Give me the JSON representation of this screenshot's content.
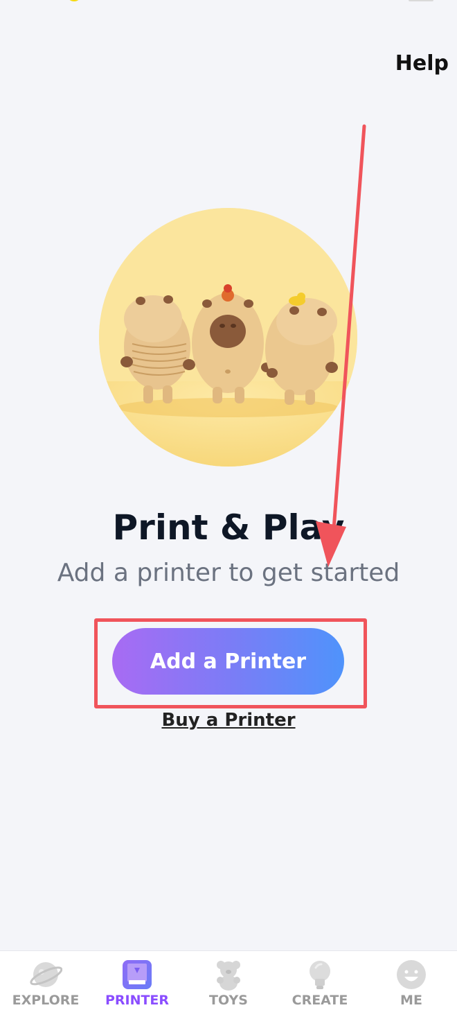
{
  "header": {
    "help_label": "Help"
  },
  "hero": {
    "title": "Print & Play",
    "subtitle": "Add a printer to get started"
  },
  "actions": {
    "add_printer_label": "Add a Printer",
    "buy_printer_label": "Buy a Printer"
  },
  "tabs": [
    {
      "label": "EXPLORE",
      "icon": "planet-icon",
      "active": false
    },
    {
      "label": "PRINTER",
      "icon": "printer-icon",
      "active": true
    },
    {
      "label": "TOYS",
      "icon": "teddy-bear-icon",
      "active": false
    },
    {
      "label": "CREATE",
      "icon": "lightbulb-icon",
      "active": false
    },
    {
      "label": "ME",
      "icon": "smiley-face-icon",
      "active": false
    }
  ],
  "colors": {
    "accent": "#8a4dff",
    "button_gradient_start": "#a86bf3",
    "button_gradient_end": "#4f93fb",
    "annotation_red": "#f0545b",
    "hero_bg": "#fbe59d"
  }
}
